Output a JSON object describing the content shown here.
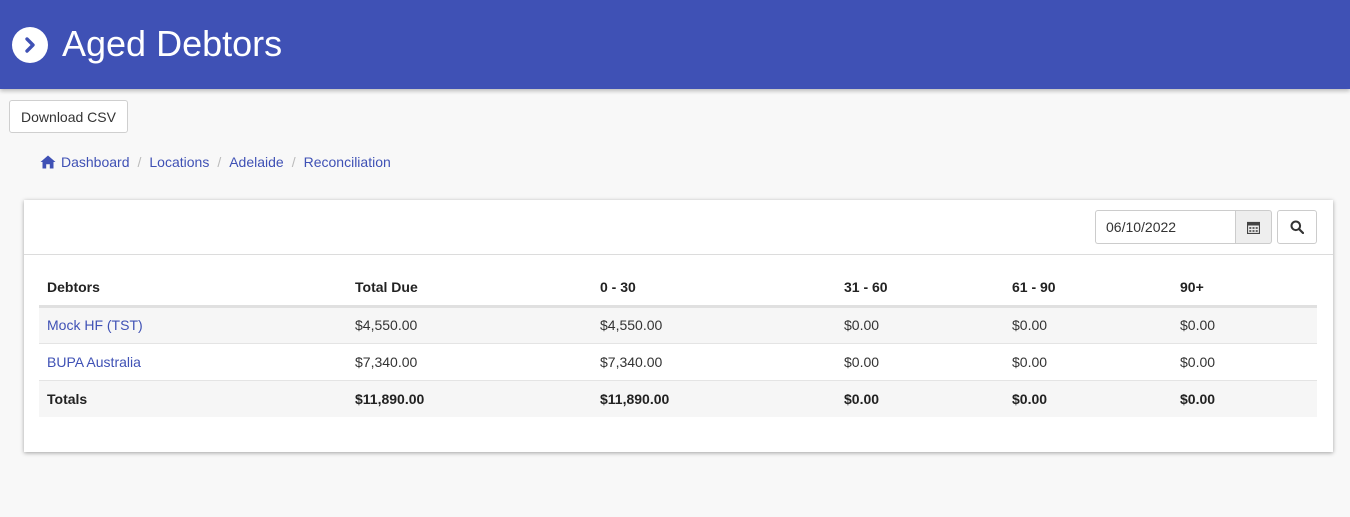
{
  "header": {
    "title": "Aged Debtors",
    "icon": "chevron-right-circle-icon"
  },
  "toolbar": {
    "download_label": "Download CSV"
  },
  "breadcrumb": {
    "home_icon": "home-icon",
    "items": [
      {
        "label": "Dashboard"
      },
      {
        "label": "Locations"
      },
      {
        "label": "Adelaide"
      },
      {
        "label": "Reconciliation"
      }
    ]
  },
  "filter": {
    "date_value": "06/10/2022",
    "calendar_icon": "calendar-icon",
    "search_icon": "search-icon"
  },
  "table": {
    "columns": [
      "Debtors",
      "Total Due",
      "0 - 30",
      "31 - 60",
      "61 - 90",
      "90+"
    ],
    "rows": [
      {
        "debtor": "Mock HF (TST)",
        "total_due": "$4,550.00",
        "d0_30": "$4,550.00",
        "d31_60": "$0.00",
        "d61_90": "$0.00",
        "d90": "$0.00"
      },
      {
        "debtor": "BUPA Australia",
        "total_due": "$7,340.00",
        "d0_30": "$7,340.00",
        "d31_60": "$0.00",
        "d61_90": "$0.00",
        "d90": "$0.00"
      }
    ],
    "totals": {
      "label": "Totals",
      "total_due": "$11,890.00",
      "d0_30": "$11,890.00",
      "d31_60": "$0.00",
      "d61_90": "$0.00",
      "d90": "$0.00"
    }
  },
  "colors": {
    "primary": "#3f51b5",
    "background": "#f8f8f8"
  }
}
